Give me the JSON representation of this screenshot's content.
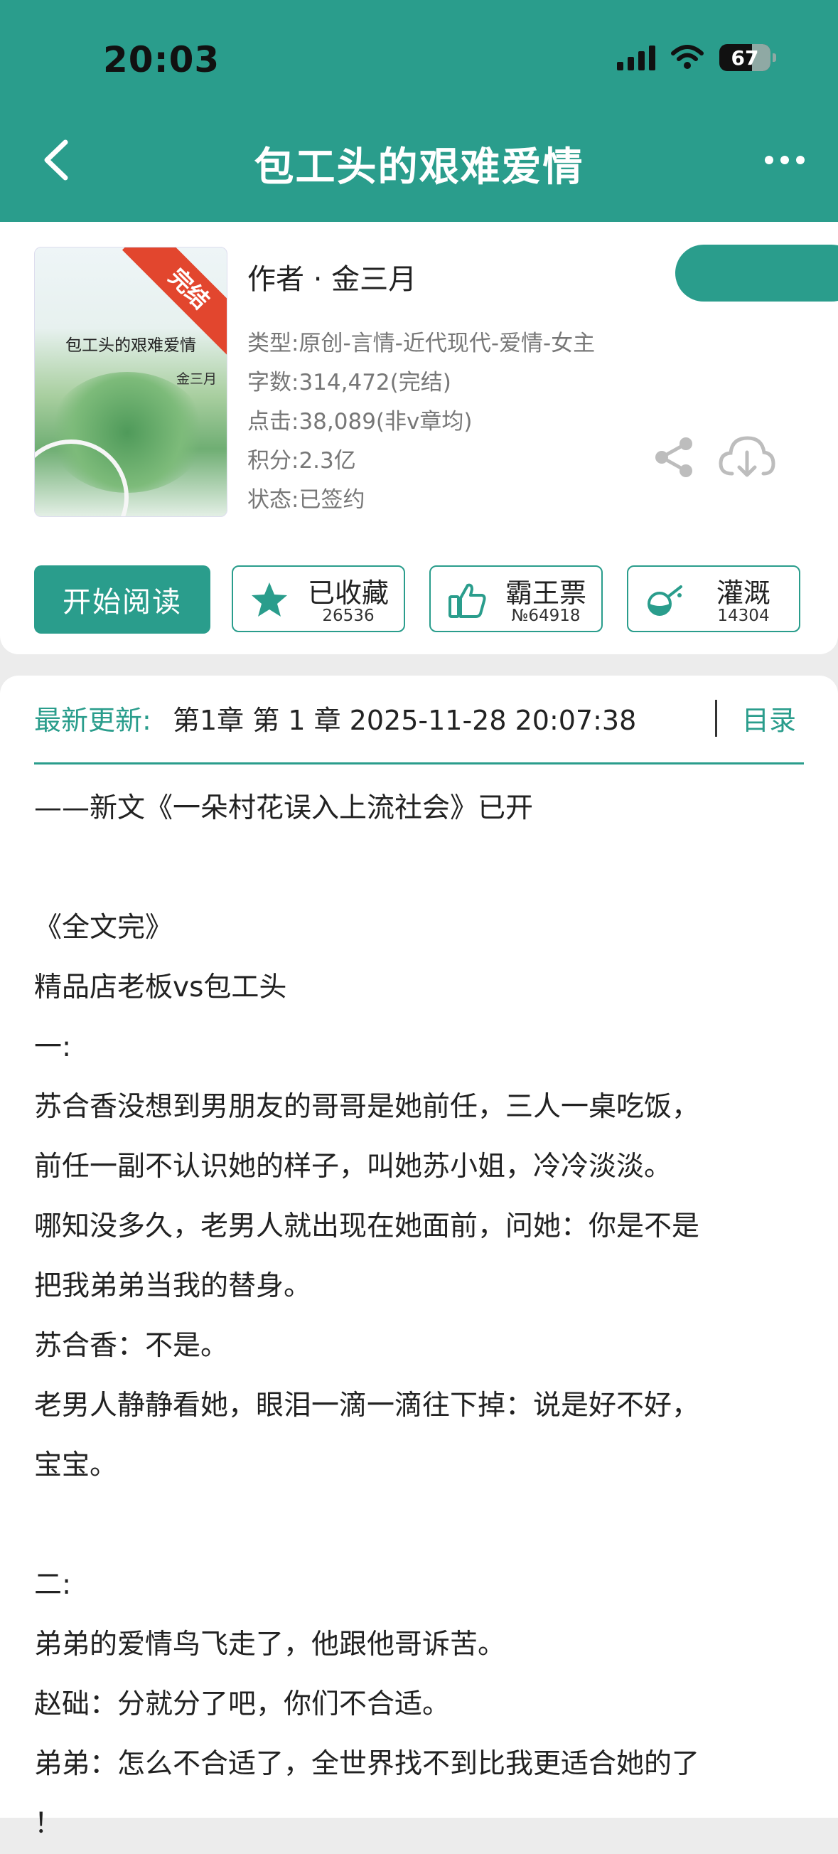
{
  "status_bar": {
    "time": "20:03",
    "battery": "67"
  },
  "header": {
    "title": "包工头的艰难爱情"
  },
  "book": {
    "cover": {
      "ribbon": "完结",
      "title": "包工头的艰难爱情",
      "author": "金三月"
    },
    "author_line": "作者 · 金三月",
    "meta": [
      "类型:原创-言情-近代现代-爱情-女主",
      "字数:314,472(完结)",
      "点击:38,089(非v章均)",
      "积分:2.3亿",
      "状态:已签约"
    ]
  },
  "actions": {
    "read": "开始阅读",
    "buttons": [
      {
        "label": "已收藏",
        "count": "26536",
        "icon": "star-icon"
      },
      {
        "label": "霸王票",
        "count": "№64918",
        "icon": "thumbs-up-icon"
      },
      {
        "label": "灌溉",
        "count": "14304",
        "icon": "watering-can-icon"
      }
    ]
  },
  "latest": {
    "label": "最新更新:",
    "text": "第1章 第 1 章 2025-11-28 20:07:38",
    "toc": "目录"
  },
  "description": [
    "——新文《一朵村花误入上流社会》已开",
    "",
    "《全文完》",
    "精品店老板vs包工头",
    "一:",
    "苏合香没想到男朋友的哥哥是她前任，三人一桌吃饭，",
    "前任一副不认识她的样子，叫她苏小姐，冷冷淡淡。",
    "哪知没多久，老男人就出现在她面前，问她：你是不是",
    "把我弟弟当我的替身。",
    "苏合香：不是。",
    "老男人静静看她，眼泪一滴一滴往下掉：说是好不好，",
    "宝宝。",
    "",
    "二:",
    "弟弟的爱情鸟飞走了，他跟他哥诉苦。",
    "赵础：分就分了吧，你们不合适。",
    "弟弟：怎么不合适了，全世界找不到比我更适合她的了",
    "！"
  ]
}
